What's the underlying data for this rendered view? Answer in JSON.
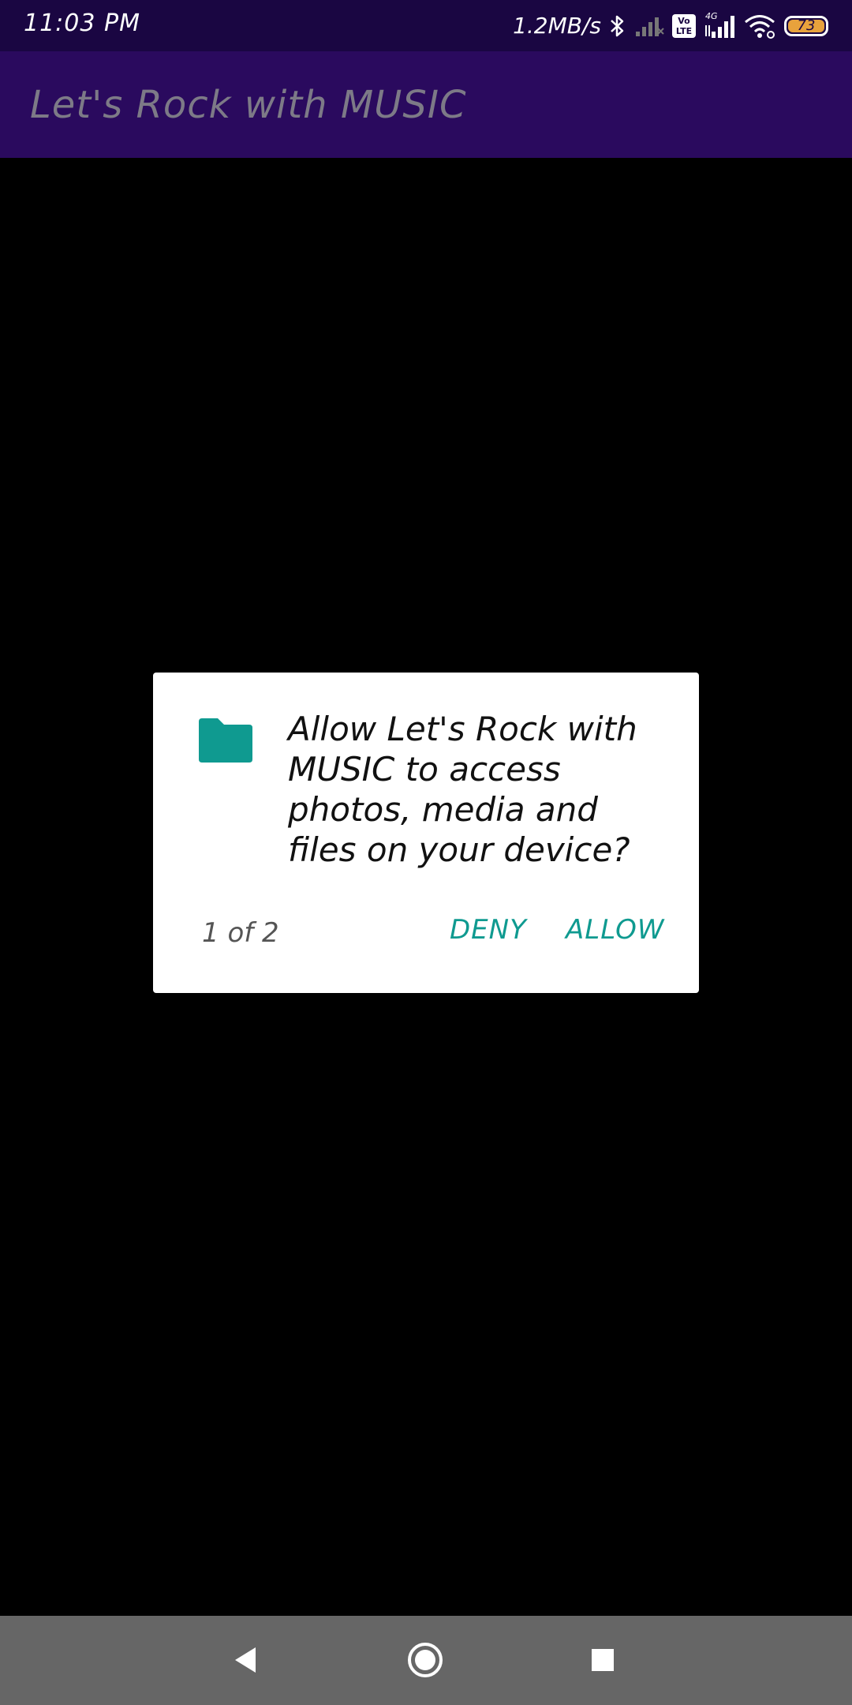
{
  "status_bar": {
    "time": "11:03 PM",
    "net_speed": "1.2MB/s",
    "volte_label_top": "Vo",
    "volte_label_bottom": "LTE",
    "network_type": "4G",
    "battery_level": "73",
    "icons": [
      "bluetooth-icon",
      "signal-icon",
      "volte-icon",
      "signal-4g-icon",
      "wifi-icon",
      "battery-icon"
    ]
  },
  "app_bar": {
    "title": "Let's Rock with MUSIC"
  },
  "permission_dialog": {
    "icon": "folder-icon",
    "message": "Allow Let's Rock with MUSIC to access photos, media and files on your device?",
    "counter": "1 of 2",
    "deny_label": "DENY",
    "allow_label": "ALLOW",
    "accent_color": "#0f9a90"
  },
  "nav_bar": {
    "buttons": [
      "back-icon",
      "home-icon",
      "recents-icon"
    ]
  },
  "colors": {
    "status_bar": "#1a0642",
    "app_bar": "#2a0a5e",
    "background": "#000000",
    "nav_bar": "#666666",
    "battery": "#e8a23c"
  }
}
